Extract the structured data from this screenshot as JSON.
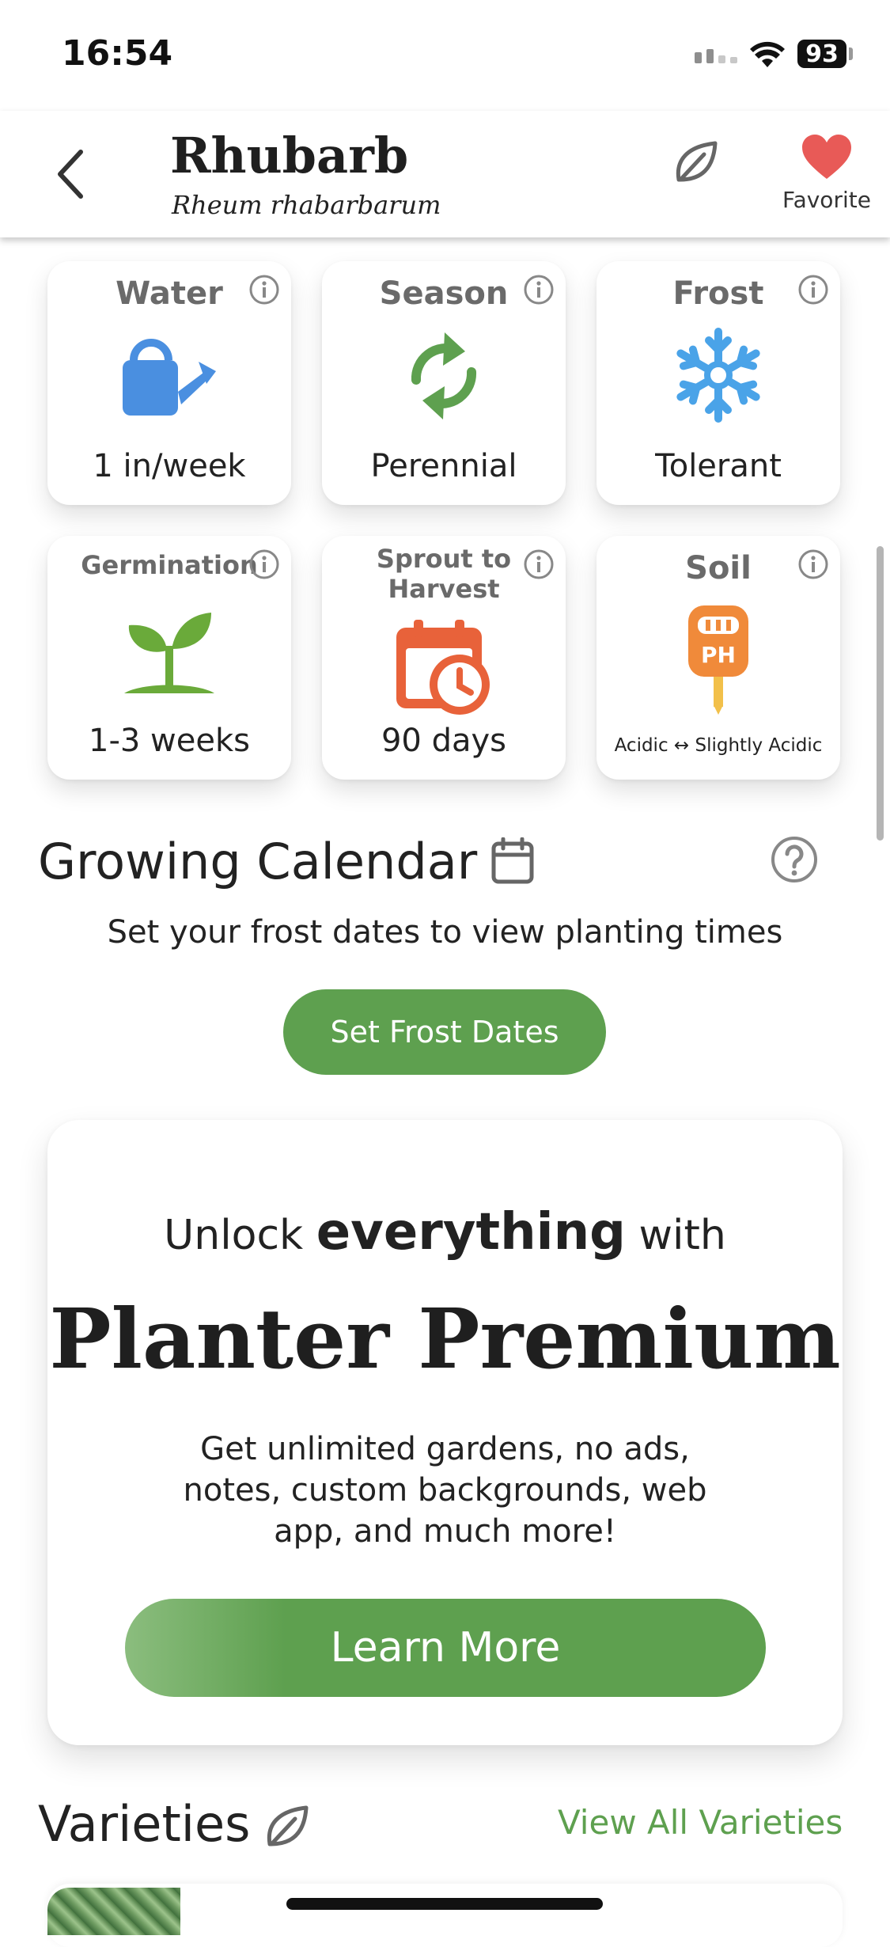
{
  "status_bar": {
    "time": "16:54",
    "battery": "93"
  },
  "header": {
    "title": "Rhubarb",
    "subtitle": "Rheum rhabarbarum",
    "favorite_label": "Favorite"
  },
  "cards": [
    {
      "title": "Water",
      "value": "1 in/week",
      "icon": "watering-can-icon",
      "color": "#4a8fe0"
    },
    {
      "title": "Season",
      "value": "Perennial",
      "icon": "cycle-arrows-icon",
      "color": "#5ea04f"
    },
    {
      "title": "Frost",
      "value": "Tolerant",
      "icon": "snowflake-icon",
      "color": "#4aa3e8"
    },
    {
      "title": "Germination",
      "value": "1-3 weeks",
      "icon": "sprout-icon",
      "color": "#6aaa3a"
    },
    {
      "title": "Sprout to Harvest",
      "value": "90 days",
      "icon": "calendar-clock-icon",
      "color": "#e8623a"
    },
    {
      "title": "Soil",
      "value": "Acidic ↔ Slightly Acidic",
      "icon": "ph-meter-icon",
      "color": "#f08a3a"
    }
  ],
  "calendar": {
    "title": "Growing Calendar",
    "note": "Set your frost dates to view planting times",
    "button": "Set Frost Dates"
  },
  "premium": {
    "unlock_prefix": "Unlock",
    "unlock_bold": "everything",
    "unlock_suffix": "with",
    "title": "Planter Premium",
    "description": "Get unlimited gardens, no ads, notes, custom backgrounds, web app, and much more!",
    "button": "Learn More"
  },
  "varieties": {
    "title": "Varieties",
    "view_all": "View All Varieties"
  },
  "colors": {
    "accent": "#5ea04f",
    "favorite": "#e85a57"
  }
}
